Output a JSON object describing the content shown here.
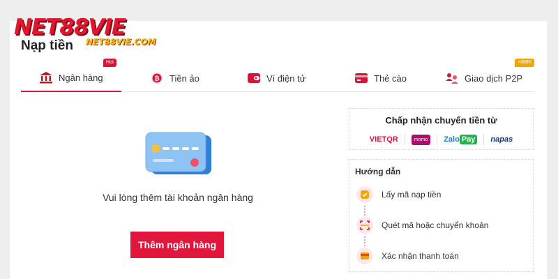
{
  "logo": {
    "main": "NET88VIE",
    "url": "NET88VIE.COM"
  },
  "page_title": "Nạp tiền",
  "tabs": [
    {
      "label": "Ngân hàng",
      "icon": "bank-icon",
      "badge": "Hot",
      "active": true
    },
    {
      "label": "Tiền ảo",
      "icon": "bitcoin-icon"
    },
    {
      "label": "Ví điện tử",
      "icon": "wallet-icon"
    },
    {
      "label": "Thẻ cào",
      "icon": "card-icon"
    },
    {
      "label": "Giao dịch P2P",
      "icon": "p2p-icon",
      "badge": "+888K"
    }
  ],
  "empty_state": {
    "illustration": "bank-card-illustration",
    "message": "Vui lòng thêm tài khoản ngân hàng",
    "button": "Thêm ngân hàng"
  },
  "accept": {
    "title": "Chấp nhận chuyển tiền từ",
    "providers": [
      "VIETQR",
      "momo",
      "Zalo",
      "Pay",
      "napas"
    ]
  },
  "guide": {
    "title": "Hướng dẫn",
    "steps": [
      {
        "label": "Lấy mã nạp tiền",
        "icon": "code-icon"
      },
      {
        "label": "Quét mã hoặc chuyển khoản",
        "icon": "scan-icon"
      },
      {
        "label": "Xác nhận thanh toán",
        "icon": "confirm-icon"
      }
    ]
  },
  "colors": {
    "accent": "#e0163c",
    "badge_gold": "#f0a500",
    "logo_yellow": "#f4c20d"
  }
}
